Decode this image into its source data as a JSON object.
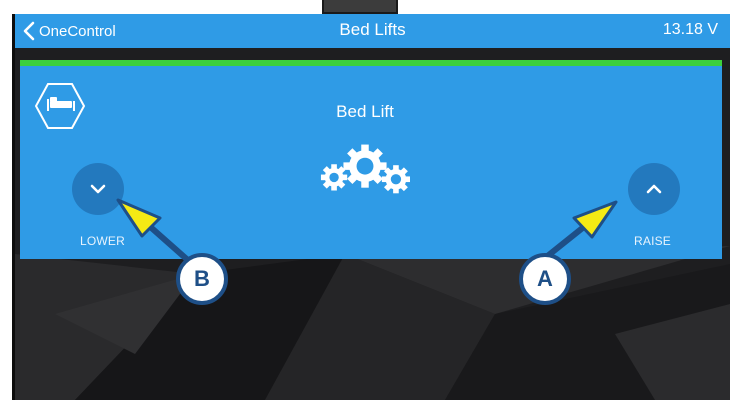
{
  "header": {
    "back_label": "OneControl",
    "title": "Bed Lifts",
    "voltage": "13.18 V"
  },
  "card": {
    "title": "Bed Lift",
    "status_color": "#3ccf3c",
    "lower_label": "LOWER",
    "raise_label": "RAISE",
    "icon": "bed-icon",
    "activity_icon": "gears-icon"
  },
  "callouts": {
    "a": "A",
    "b": "B"
  },
  "colors": {
    "accent": "#2f9be6",
    "button": "#2379be",
    "callout_border": "#1e4f87",
    "arrow_fill": "#f5ea14"
  }
}
